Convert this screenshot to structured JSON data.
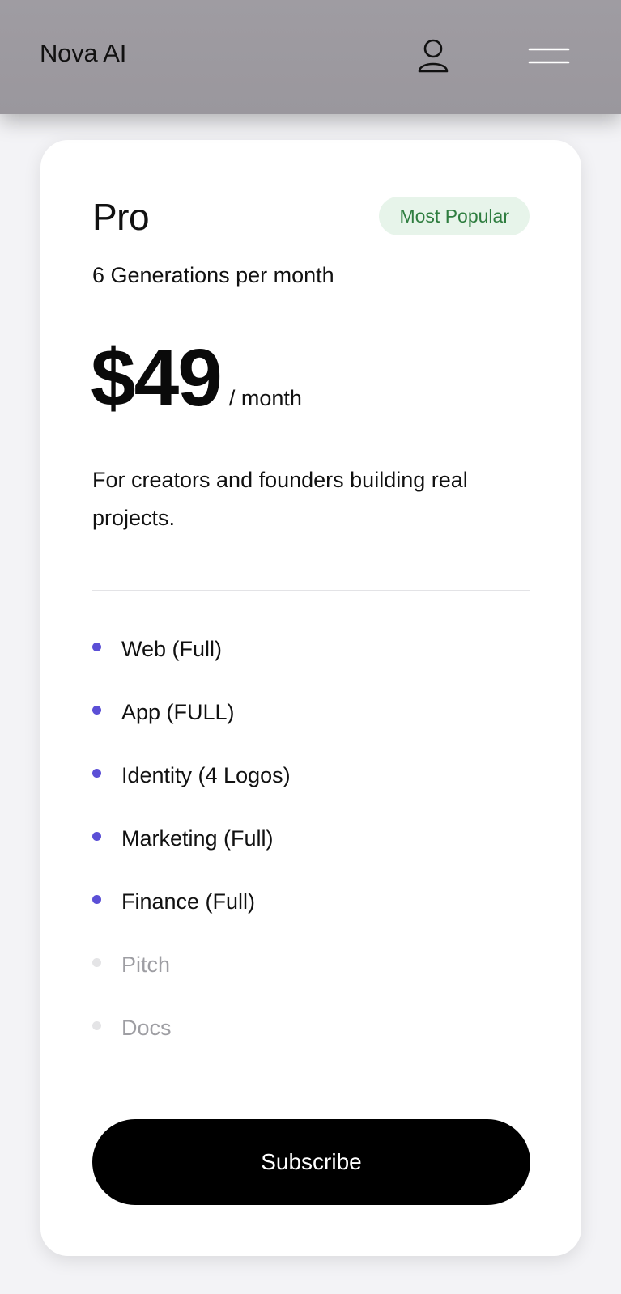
{
  "header": {
    "brand": "Nova AI",
    "user_icon": "user-icon",
    "menu_icon": "menu-icon"
  },
  "plan": {
    "name": "Pro",
    "badge": "Most Popular",
    "generations": "6 Generations per month",
    "price": "$49",
    "period": "/ month",
    "description": "For creators and founders building real projects.",
    "features": [
      {
        "label": "Web (Full)",
        "included": true
      },
      {
        "label": "App (FULL)",
        "included": true
      },
      {
        "label": "Identity (4 Logos)",
        "included": true
      },
      {
        "label": "Marketing (Full)",
        "included": true
      },
      {
        "label": "Finance (Full)",
        "included": true
      },
      {
        "label": "Pitch",
        "included": false
      },
      {
        "label": "Docs",
        "included": false
      }
    ],
    "cta": "Subscribe"
  },
  "colors": {
    "accent": "#5b4fd6",
    "badge_bg": "#e7f4ea",
    "badge_text": "#2e7d3f",
    "header_bg": "#9f9ca2",
    "button_bg": "#000000"
  }
}
